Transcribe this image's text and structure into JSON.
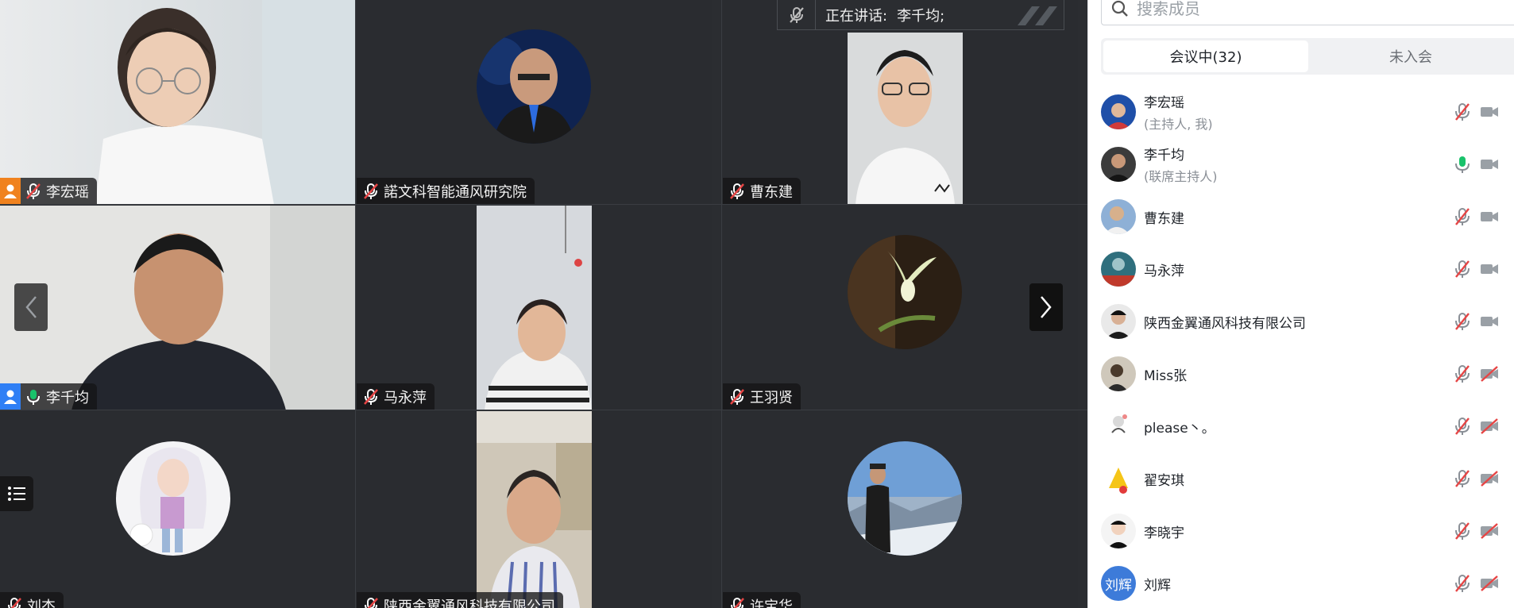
{
  "speaking": {
    "label": "正在讲话:",
    "name": "李千均;"
  },
  "tiles": [
    {
      "name": "李宏瑶",
      "mic": "muted",
      "host_icon": "orange"
    },
    {
      "name": "諾文科智能通风研究院",
      "mic": "muted"
    },
    {
      "name": "曹东建",
      "mic": "muted"
    },
    {
      "name": "李千均",
      "mic": "on",
      "host_icon": "blue"
    },
    {
      "name": "马永萍",
      "mic": "muted"
    },
    {
      "name": "王羽贤",
      "mic": "muted"
    },
    {
      "name": "刘杰",
      "mic": "muted"
    },
    {
      "name": "陕西金翼通风科技有限公司",
      "mic": "muted"
    },
    {
      "name": "许宝华",
      "mic": "muted"
    }
  ],
  "panel": {
    "search_placeholder": "搜索成员",
    "tabs": [
      {
        "label": "会议中(32)",
        "active": true
      },
      {
        "label": "未入会",
        "active": false
      }
    ],
    "members": [
      {
        "name": "李宏瑶",
        "role": "(主持人, 我)",
        "mic": "muted",
        "cam": "on",
        "avatar_color": "#2a5db0"
      },
      {
        "name": "李千均",
        "role": "(联席主持人)",
        "mic": "on",
        "cam": "on",
        "avatar_color": "#3a3a3a"
      },
      {
        "name": "曹东建",
        "role": "",
        "mic": "muted",
        "cam": "on",
        "avatar_color": "#8aa7c4"
      },
      {
        "name": "马永萍",
        "role": "",
        "mic": "muted",
        "cam": "on",
        "avatar_color": "#3a7a8a"
      },
      {
        "name": "陕西金翼通风科技有限公司",
        "role": "",
        "mic": "muted",
        "cam": "on",
        "avatar_color": "#222222"
      },
      {
        "name": "Miss张",
        "role": "",
        "mic": "muted",
        "cam": "off",
        "avatar_color": "#6b5a48"
      },
      {
        "name": "please丶。",
        "role": "",
        "mic": "muted",
        "cam": "off",
        "avatar_color": "#e8e8e8"
      },
      {
        "name": "翟安琪",
        "role": "",
        "mic": "muted",
        "cam": "off",
        "avatar_color": "#f5c518"
      },
      {
        "name": "李晓宇",
        "role": "",
        "mic": "muted",
        "cam": "off",
        "avatar_color": "#f2f2f2"
      },
      {
        "name": "刘辉",
        "role": "",
        "mic": "muted",
        "cam": "off",
        "avatar_text": "刘辉"
      }
    ]
  },
  "colors": {
    "muted_mic": "#e64545",
    "live_mic": "#19c26b",
    "active_border": "#19c26b",
    "grid_bg": "#2b2d31"
  }
}
